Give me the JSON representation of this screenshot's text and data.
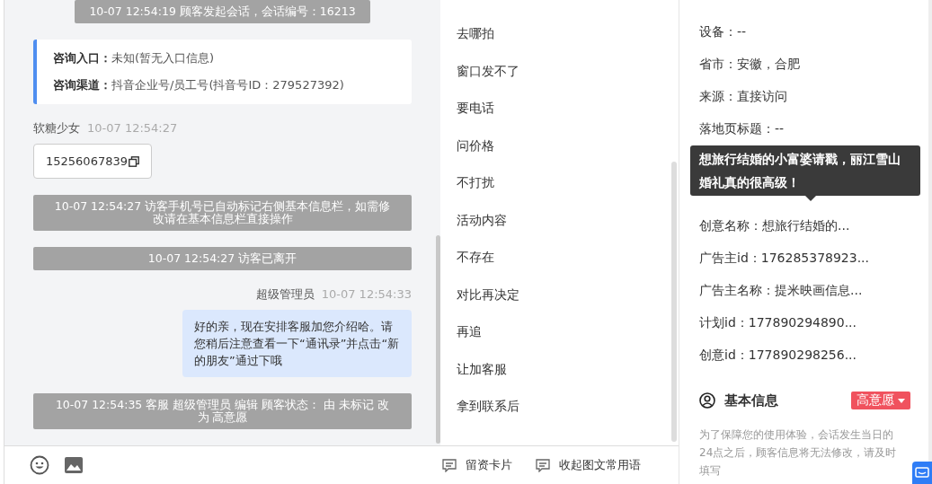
{
  "chat": {
    "messages": [
      {
        "kind": "system",
        "text": "10-07 12:54:19 顾客发起会话，会话编号：16213"
      },
      {
        "kind": "info",
        "rows": [
          {
            "label": "咨询入口：",
            "value": "未知(暂无入口信息)"
          },
          {
            "label": "咨询渠道：",
            "value": "抖音企业号/员工号(抖音号ID：279527392)"
          }
        ]
      },
      {
        "kind": "visitor",
        "sender": "软糖少女",
        "time": "10-07 12:54:27",
        "text": "15256067839"
      },
      {
        "kind": "system",
        "text": "10-07 12:54:27 访客手机号已自动标记右侧基本信息栏，如需修改请在基本信息栏直接操作"
      },
      {
        "kind": "system",
        "text": "10-07 12:54:27 访客已离开"
      },
      {
        "kind": "agent",
        "sender": "超级管理员",
        "time": "10-07 12:54:33",
        "text": "好的亲，现在安排客服加您介绍哈。请您稍后注意查看一下“通讯录”并点击“新的朋友”通过下哦"
      },
      {
        "kind": "system",
        "text": "10-07 12:54:35 客服 超级管理员 编辑 顾客状态： 由 未标记 改为 高意愿"
      }
    ]
  },
  "quick_replies": {
    "items": [
      "去哪拍",
      "窗口发不了",
      "要电话",
      "问价格",
      "不打扰",
      "活动内容",
      "不存在",
      "对比再决定",
      "再追",
      "让加客服",
      "拿到联系后"
    ],
    "actions": [
      "留资卡片",
      "收起图文常用语"
    ]
  },
  "visitor_info": {
    "rows_top": [
      "设备：--",
      "省市：安徽，合肥",
      "来源：直接访问",
      "落地页标题：--"
    ],
    "tooltip": "想旅行结婚的小富婆请戳，丽江雪山婚礼真的很高级！",
    "rows_bottom": [
      "创意名称：想旅行结婚的...",
      "广告主id：176285378923...",
      "广告主名称：提米映画信息...",
      "计划id：177890294890...",
      "创意id：177890298256..."
    ],
    "basic_info": {
      "title": "基本信息",
      "status": "高意愿",
      "notice": "为了保障您的使用体验，会话发生当日的24点之后，顾客信息将无法修改，请及时填写"
    }
  }
}
